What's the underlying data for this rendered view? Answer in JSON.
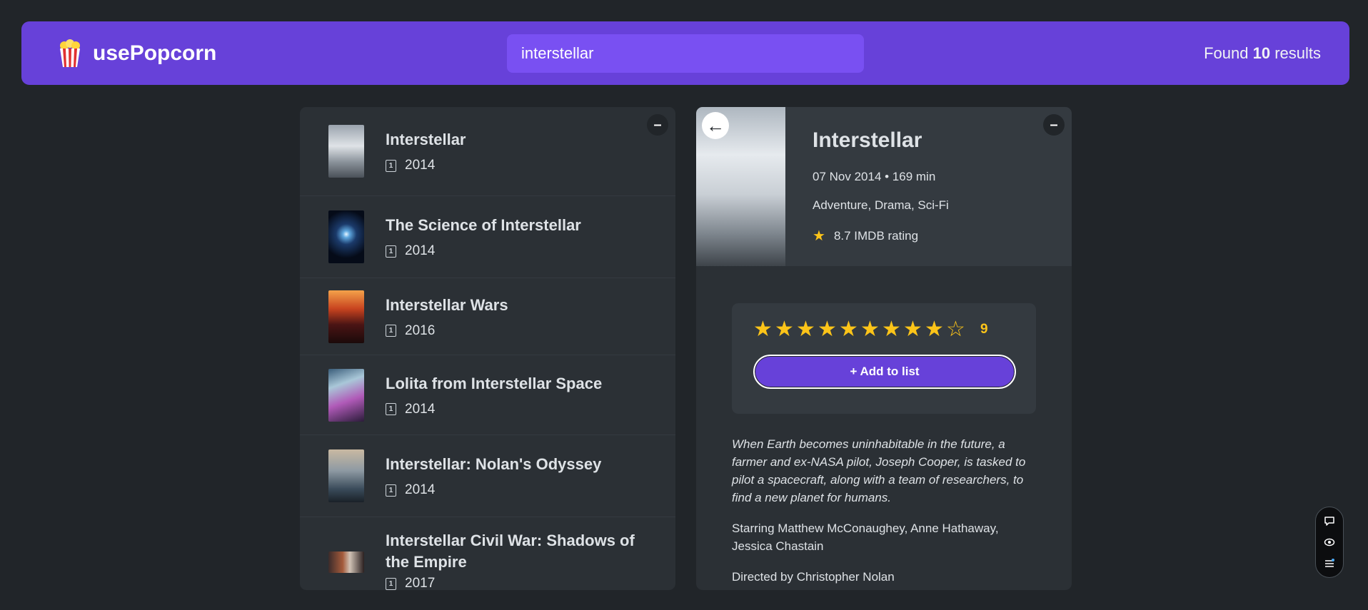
{
  "nav": {
    "logo_emoji": "🍿",
    "app_name": "usePopcorn",
    "search_value": "interstellar",
    "results_prefix": "Found",
    "results_count": "10",
    "results_suffix": "results"
  },
  "list": {
    "toggle_label": "–",
    "movies": [
      {
        "title": "Interstellar",
        "year": "2014"
      },
      {
        "title": "The Science of Interstellar",
        "year": "2014"
      },
      {
        "title": "Interstellar Wars",
        "year": "2016"
      },
      {
        "title": "Lolita from Interstellar Space",
        "year": "2014"
      },
      {
        "title": "Interstellar: Nolan's Odyssey",
        "year": "2014"
      },
      {
        "title": "Interstellar Civil War: Shadows of the Empire",
        "year": "2017"
      }
    ]
  },
  "details": {
    "toggle_label": "–",
    "back_label": "←",
    "title": "Interstellar",
    "release_runtime": "07 Nov 2014 • 169 min",
    "genre": "Adventure, Drama, Sci-Fi",
    "imdb_rating": "8.7 IMDB rating",
    "user_rating": "9",
    "user_rating_value": 9,
    "max_rating": 10,
    "add_button": "+ Add to list",
    "plot": "When Earth becomes uninhabitable in the future, a farmer and ex-NASA pilot, Joseph Cooper, is tasked to pilot a spacecraft, along with a team of researchers, to find a new planet for humans.",
    "actors": "Starring Matthew McConaughey, Anne Hathaway, Jessica Chastain",
    "director": "Directed by Christopher Nolan"
  },
  "colors": {
    "primary": "#6741d9",
    "primary_light": "#7950f2",
    "background": "#212529",
    "box": "#2b3035",
    "star": "#fcc419"
  },
  "widget": {
    "icons": [
      "chat-icon",
      "eye-icon",
      "menu-icon"
    ]
  }
}
